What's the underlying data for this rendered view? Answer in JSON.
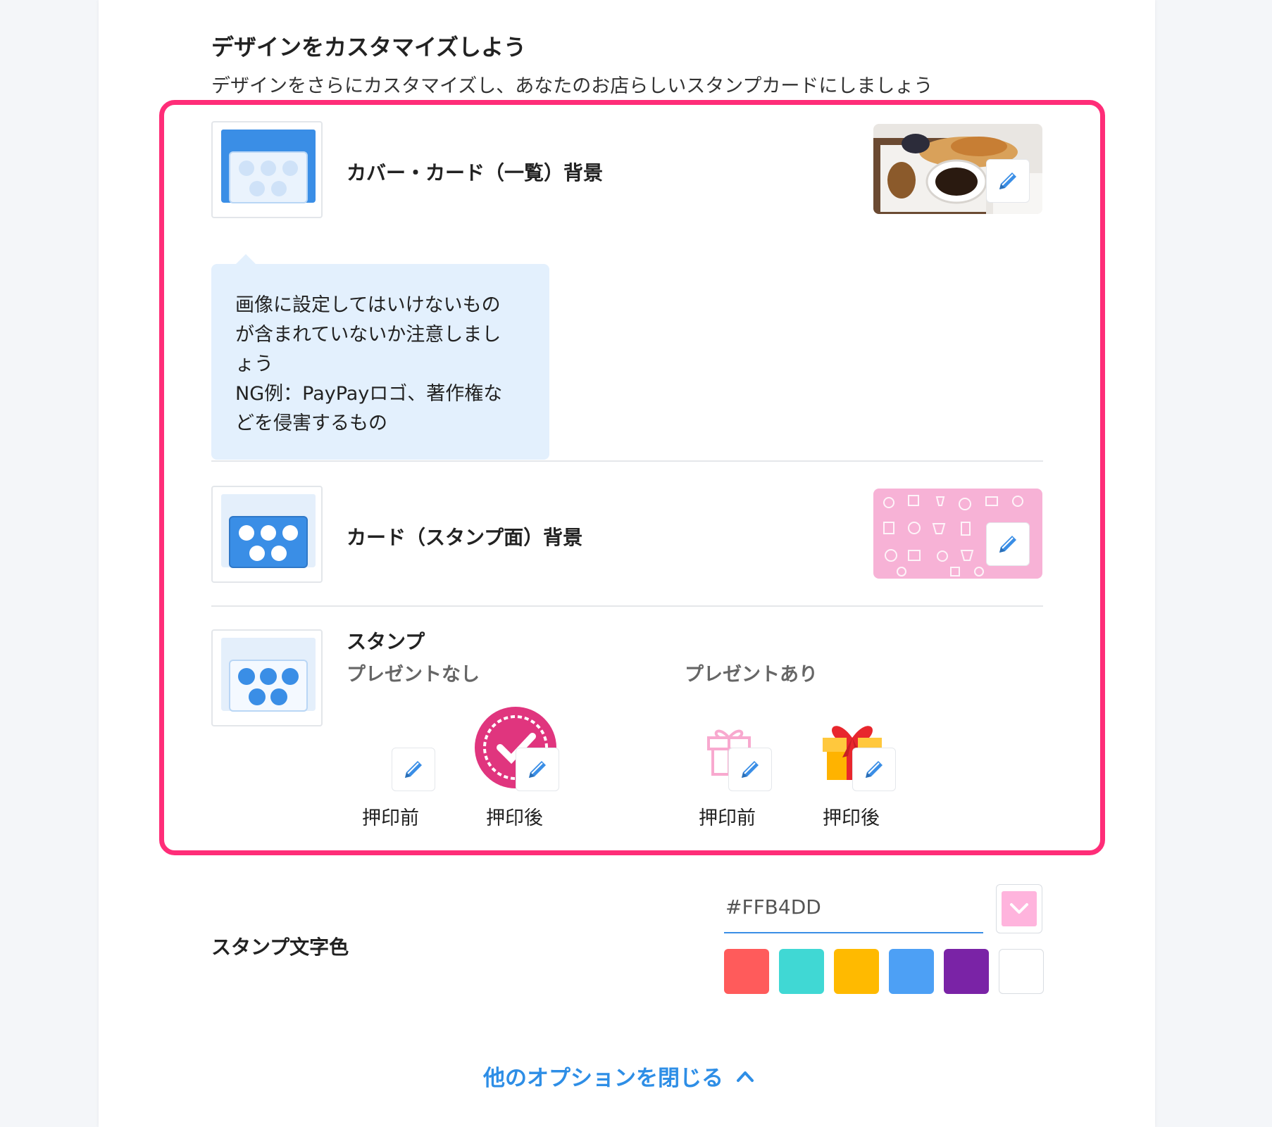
{
  "header": {
    "title": "デザインをカスタマイズしよう",
    "subtitle": "デザインをさらにカスタマイズし、あなたのお店らしいスタンプカードにしましょう"
  },
  "cover_row": {
    "label": "カバー・カード（一覧）背景",
    "icon": "card-list-icon",
    "thumbnail": "breakfast-photo"
  },
  "tooltip": {
    "lines": [
      "画像に設定してはいけないもの",
      "が含まれていないか注意しまし",
      "ょう",
      "NG例：PayPayロゴ、著作権な",
      "どを侵害するもの"
    ]
  },
  "card_row": {
    "label": "カード（スタンプ面）背景",
    "icon": "stamp-face-icon",
    "thumbnail": "pink-pattern"
  },
  "stamp_row": {
    "label": "スタンプ",
    "no_present": "プレゼントなし",
    "with_present": "プレゼントあり",
    "before": "押印前",
    "after": "押印後"
  },
  "stamp_color": {
    "label": "スタンプ文字色",
    "value": "#FFB4DD",
    "swatches": [
      "#ff5b5b",
      "#40d8d4",
      "#ffba00",
      "#4da0f5",
      "#7a23a6",
      "#ffffff"
    ]
  },
  "footer": {
    "close_label": "他のオプションを閉じる"
  },
  "colors": {
    "accent": "#ff2d78",
    "link": "#2e8ee6",
    "tooltip_bg": "#e3f0fd",
    "stamp_pink": "#e0357e",
    "edit_pencil": "#3a8ee6"
  }
}
